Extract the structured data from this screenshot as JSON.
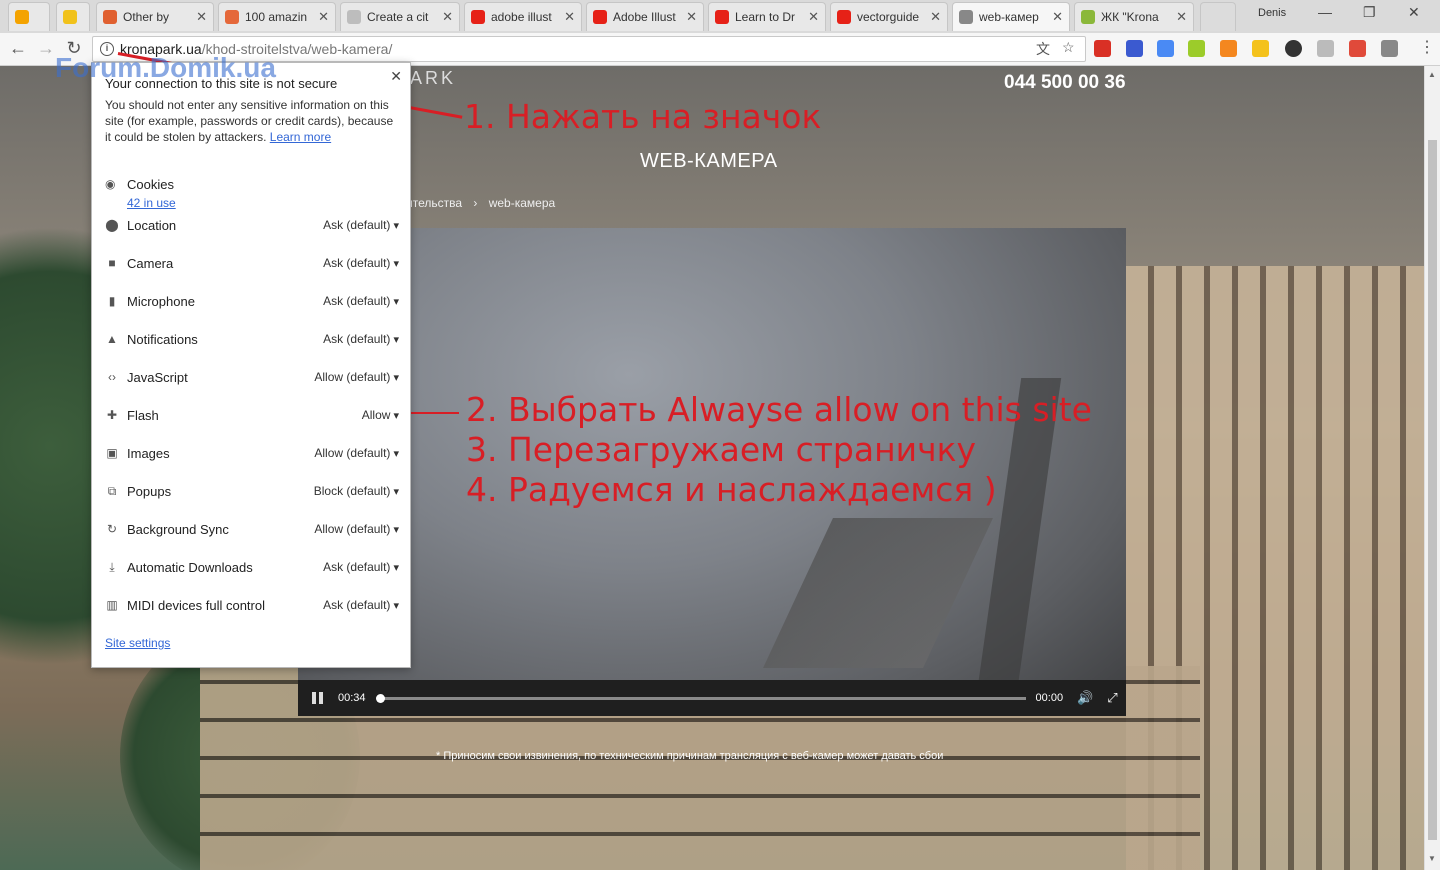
{
  "tabs": [
    {
      "label": "",
      "color": "#f4a300"
    },
    {
      "label": "",
      "color": "#f1c21b"
    },
    {
      "label": "Other by",
      "color": "#e06030"
    },
    {
      "label": "100 amazin",
      "color": "#e5683a"
    },
    {
      "label": "Create a cit",
      "color": "#bdbdbd"
    },
    {
      "label": "adobe illust",
      "color": "#e62117"
    },
    {
      "label": "Adobe Illust",
      "color": "#e62117"
    },
    {
      "label": "Learn to Dr",
      "color": "#e62117"
    },
    {
      "label": "vectorguide",
      "color": "#e62117"
    },
    {
      "label": "web-камер",
      "color": "#888888"
    },
    {
      "label": "ЖК \"Krona",
      "color": "#8bb83a"
    }
  ],
  "user": "Denis",
  "url": {
    "host": "kronapark.ua",
    "path": "/khod-stroitelstva/web-kamera/"
  },
  "page": {
    "phone": "044 500 00 36",
    "logo": "ARK",
    "title": "WEB-КАМЕРА",
    "breadcrumbs": [
      "ительства",
      "›",
      "web-камера"
    ],
    "note": "* Приносим свои извинения, по техническим причинам трансляция с веб-камер может давать сбои"
  },
  "video": {
    "current": "00:34",
    "duration": "00:00",
    "progress": 0.0
  },
  "popup": {
    "warn_title": "Your connection to this site is not secure",
    "warn_body": "You should not enter any sensitive information on this site (for example, passwords or credit cards), because it could be stolen by attackers.",
    "learn_more": "Learn more",
    "cookies_label": "Cookies",
    "cookies_sub": "42 in use",
    "permissions": [
      {
        "label": "Location",
        "value": "Ask (default)",
        "icon": "location-icon",
        "glyph": "⬤"
      },
      {
        "label": "Camera",
        "value": "Ask (default)",
        "icon": "camera-icon",
        "glyph": "■"
      },
      {
        "label": "Microphone",
        "value": "Ask (default)",
        "icon": "microphone-icon",
        "glyph": "▮"
      },
      {
        "label": "Notifications",
        "value": "Ask (default)",
        "icon": "bell-icon",
        "glyph": "▲"
      },
      {
        "label": "JavaScript",
        "value": "Allow (default)",
        "icon": "code-icon",
        "glyph": "‹›"
      },
      {
        "label": "Flash",
        "value": "Allow",
        "icon": "puzzle-icon",
        "glyph": "✚"
      },
      {
        "label": "Images",
        "value": "Allow (default)",
        "icon": "image-icon",
        "glyph": "▣"
      },
      {
        "label": "Popups",
        "value": "Block (default)",
        "icon": "popup-icon",
        "glyph": "⧉"
      },
      {
        "label": "Background Sync",
        "value": "Allow (default)",
        "icon": "sync-icon",
        "glyph": "↻"
      },
      {
        "label": "Automatic Downloads",
        "value": "Ask (default)",
        "icon": "download-icon",
        "glyph": "⤓"
      },
      {
        "label": "MIDI devices full control",
        "value": "Ask (default)",
        "icon": "midi-icon",
        "glyph": "▥"
      }
    ],
    "site_settings": "Site settings"
  },
  "annotations": {
    "step1": "1. Нажать на значок",
    "step2": "2. Выбрать Alwayse allow on this site",
    "step3": "3. Перезагружаем страничку",
    "step4": "4. Радуемся и наслаждаемся )"
  },
  "watermark": "Forum.Domik.ua"
}
